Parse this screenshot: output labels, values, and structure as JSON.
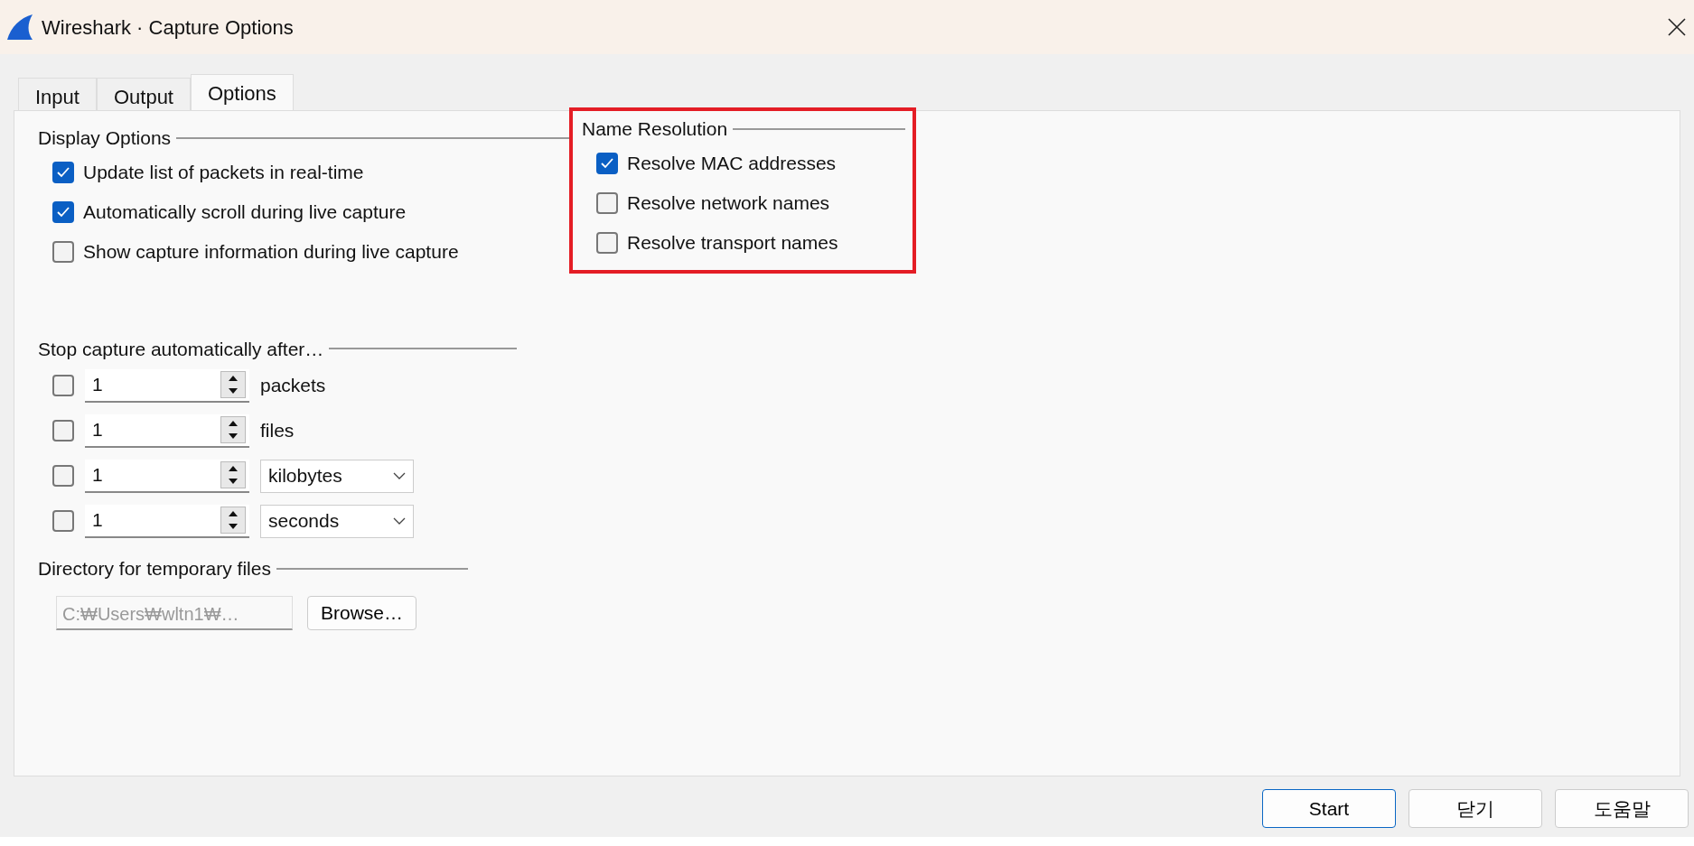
{
  "window": {
    "title": "Wireshark · Capture Options"
  },
  "tabs": [
    {
      "label": "Input",
      "selected": false
    },
    {
      "label": "Output",
      "selected": false
    },
    {
      "label": "Options",
      "selected": true
    }
  ],
  "display_options": {
    "title": "Display Options",
    "items": [
      {
        "label": "Update list of packets in real-time",
        "checked": true
      },
      {
        "label": "Automatically scroll during live capture",
        "checked": true
      },
      {
        "label": "Show capture information during live capture",
        "checked": false
      }
    ]
  },
  "name_resolution": {
    "title": "Name Resolution",
    "highlighted": true,
    "items": [
      {
        "label": "Resolve MAC addresses",
        "checked": true
      },
      {
        "label": "Resolve network names",
        "checked": false
      },
      {
        "label": "Resolve transport names",
        "checked": false
      }
    ]
  },
  "stop_capture": {
    "title": "Stop capture automatically after…",
    "rows": [
      {
        "checked": false,
        "value": "1",
        "kind": "label",
        "unit": "packets"
      },
      {
        "checked": false,
        "value": "1",
        "kind": "label",
        "unit": "files"
      },
      {
        "checked": false,
        "value": "1",
        "kind": "dropdown",
        "unit": "kilobytes"
      },
      {
        "checked": false,
        "value": "1",
        "kind": "dropdown",
        "unit": "seconds"
      }
    ]
  },
  "temp_directory": {
    "title": "Directory for temporary files",
    "path": "C:₩Users₩wltn1₩…",
    "disabled": true,
    "browse_button": "Browse…"
  },
  "buttons": [
    {
      "label": "Start",
      "default": true
    },
    {
      "label": "닫기",
      "default": false
    },
    {
      "label": "도움말",
      "default": false
    }
  ]
}
